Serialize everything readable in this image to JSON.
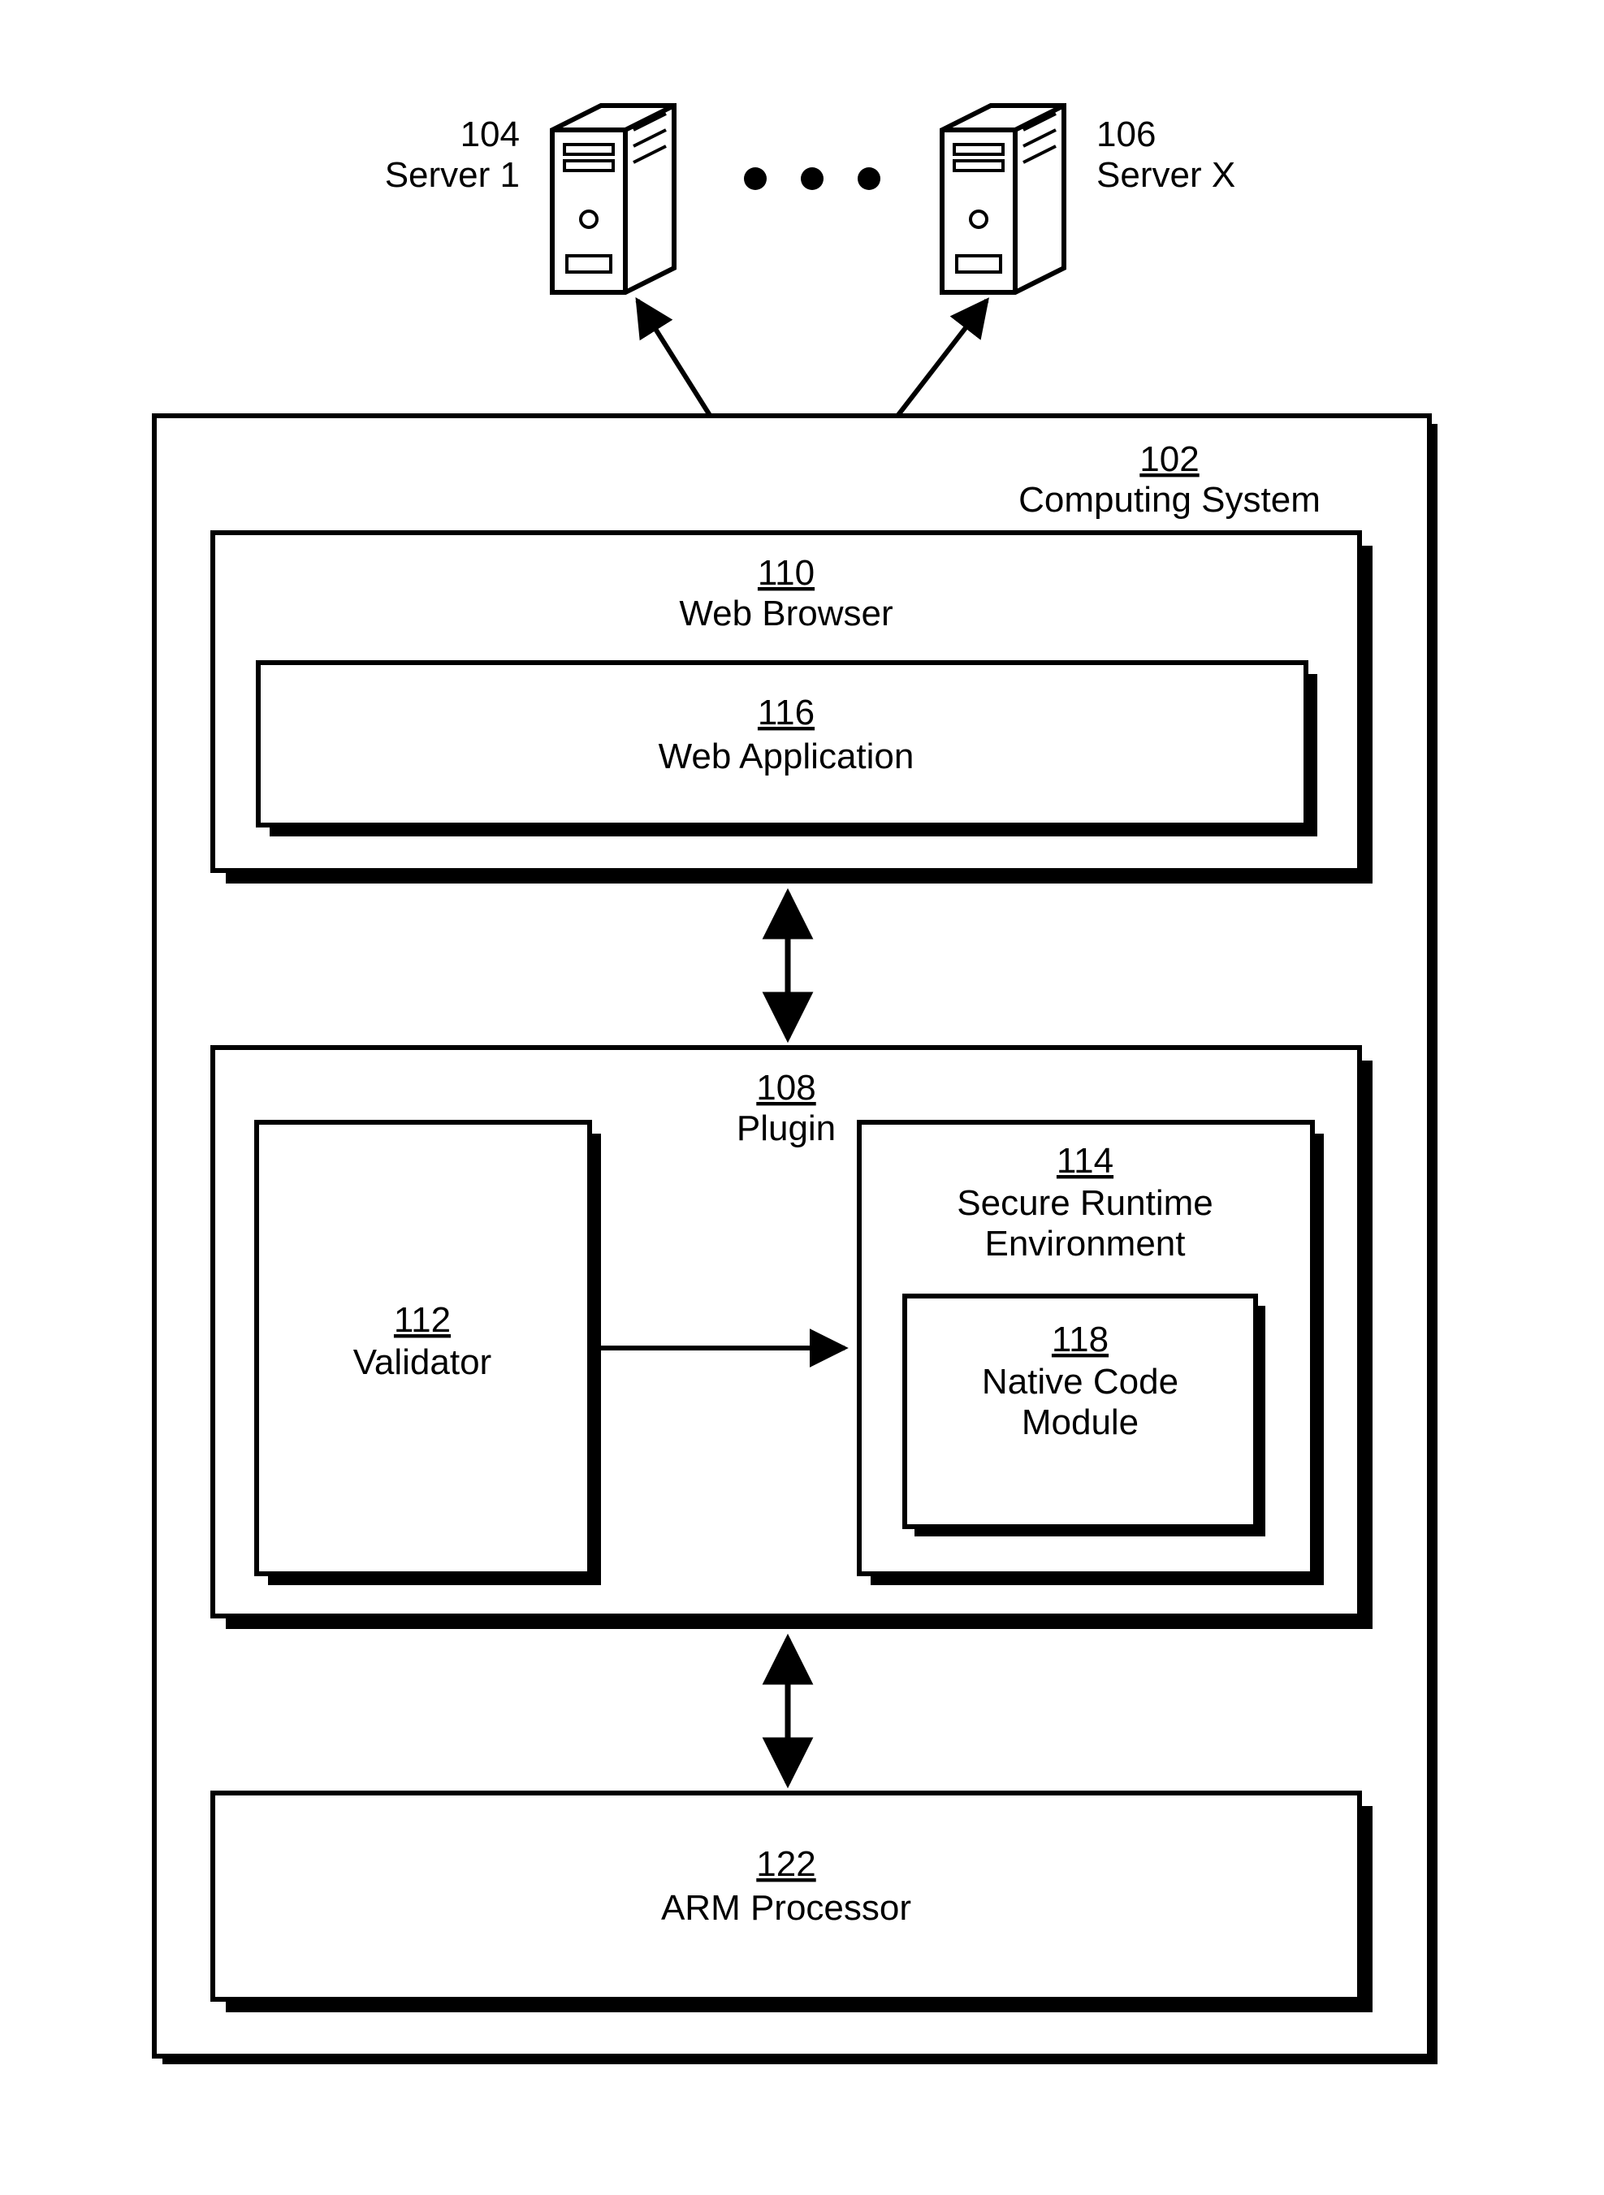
{
  "servers": {
    "left": {
      "ref": "104",
      "name": "Server 1"
    },
    "right": {
      "ref": "106",
      "name": "Server X"
    }
  },
  "computing_system": {
    "ref": "102",
    "name": "Computing System"
  },
  "web_browser": {
    "ref": "110",
    "name": "Web Browser"
  },
  "web_application": {
    "ref": "116",
    "name": "Web Application"
  },
  "plugin": {
    "ref": "108",
    "name": "Plugin"
  },
  "validator": {
    "ref": "112",
    "name": "Validator"
  },
  "secure_runtime": {
    "ref": "114",
    "line1": "Secure Runtime",
    "line2": "Environment"
  },
  "native_code": {
    "ref": "118",
    "line1": "Native Code",
    "line2": "Module"
  },
  "arm_processor": {
    "ref": "122",
    "name": "ARM Processor"
  }
}
